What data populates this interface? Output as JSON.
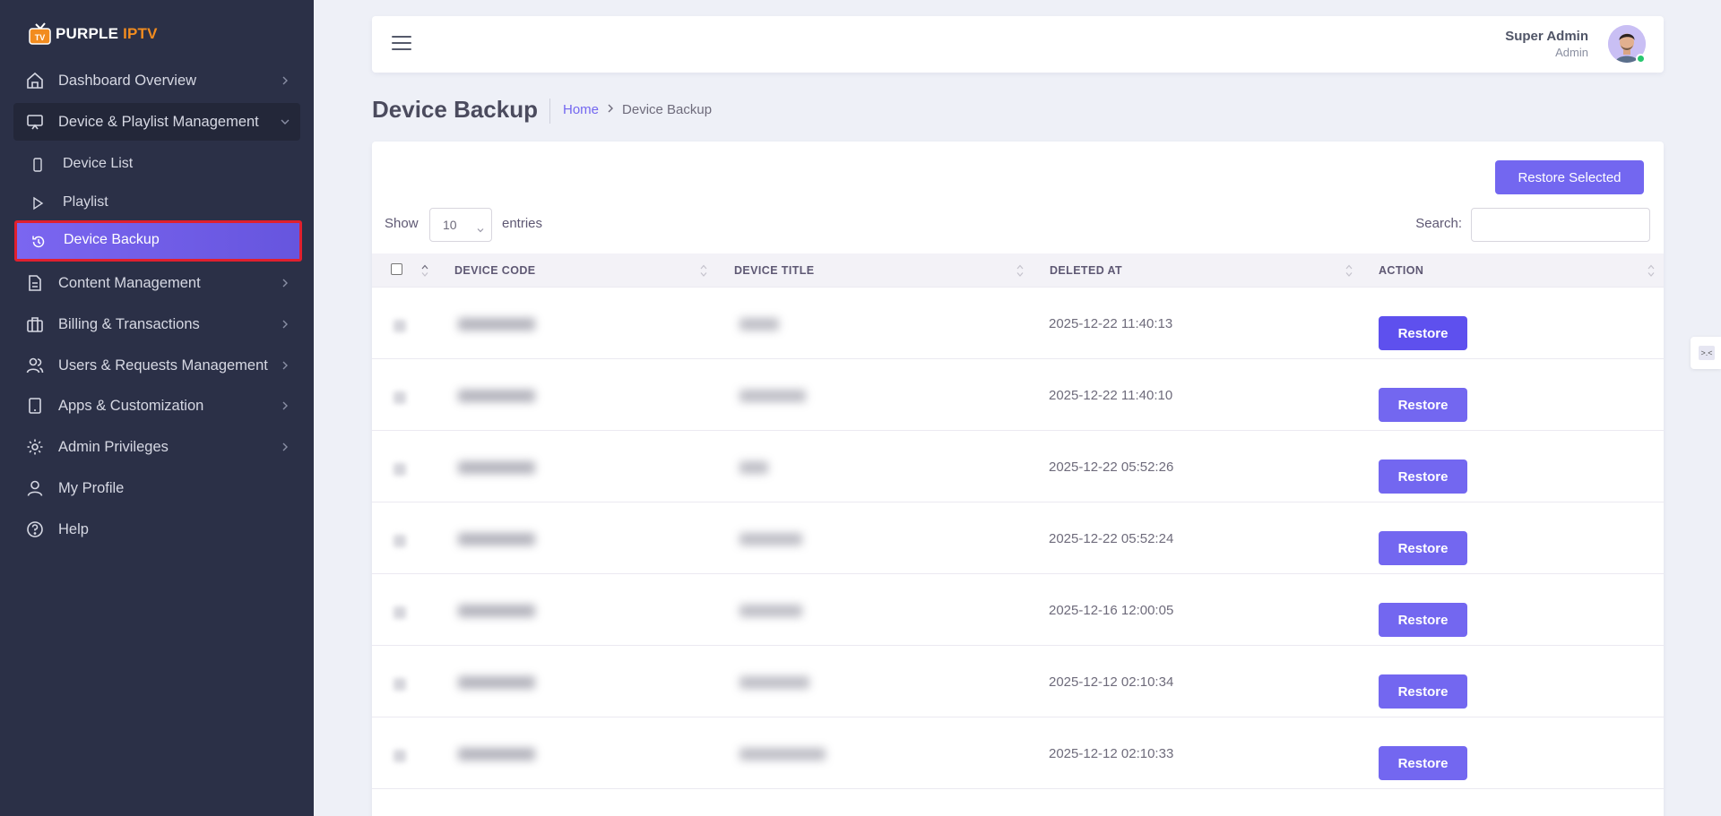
{
  "brand": {
    "name_main": "PURPLE",
    "name_accent": "IPTV",
    "logo_icon": "tv-icon",
    "accent_color": "#f28c1f"
  },
  "sidebar": {
    "items": [
      {
        "label": "Dashboard Overview",
        "icon": "home-icon"
      },
      {
        "label": "Device & Playlist Management",
        "icon": "monitor-icon"
      },
      {
        "label": "Content Management",
        "icon": "document-icon"
      },
      {
        "label": "Billing & Transactions",
        "icon": "briefcase-icon"
      },
      {
        "label": "Users & Requests Management",
        "icon": "users-icon"
      },
      {
        "label": "Apps & Customization",
        "icon": "tablet-icon"
      },
      {
        "label": "Admin Privileges",
        "icon": "gear-icon"
      },
      {
        "label": "My Profile",
        "icon": "user-icon"
      },
      {
        "label": "Help",
        "icon": "help-icon"
      }
    ],
    "subitems": [
      {
        "label": "Device List",
        "icon": "phone-icon"
      },
      {
        "label": "Playlist",
        "icon": "play-icon"
      },
      {
        "label": "Device Backup",
        "icon": "restore-icon"
      }
    ]
  },
  "header": {
    "user_name": "Super Admin",
    "user_role": "Admin"
  },
  "page": {
    "title": "Device Backup",
    "breadcrumb_home": "Home",
    "breadcrumb_current": "Device Backup"
  },
  "table_controls": {
    "restore_selected_label": "Restore Selected",
    "show_label": "Show",
    "page_length": "10",
    "entries_label": "entries",
    "search_label": "Search:"
  },
  "table": {
    "columns": [
      "DEVICE CODE",
      "DEVICE TITLE",
      "DELETED AT",
      "ACTION"
    ],
    "rows": [
      {
        "deleted_at": "2025-12-22 11:40:13",
        "action": "Restore"
      },
      {
        "deleted_at": "2025-12-22 11:40:10",
        "action": "Restore"
      },
      {
        "deleted_at": "2025-12-22 05:52:26",
        "action": "Restore"
      },
      {
        "deleted_at": "2025-12-22 05:52:24",
        "action": "Restore"
      },
      {
        "deleted_at": "2025-12-16 12:00:05",
        "action": "Restore"
      },
      {
        "deleted_at": "2025-12-12 02:10:34",
        "action": "Restore"
      },
      {
        "deleted_at": "2025-12-12 02:10:33",
        "action": "Restore"
      }
    ]
  },
  "colors": {
    "primary": "#7367f0",
    "sidebar_bg": "#2b3047",
    "active_highlight_border": "#e0202e",
    "online": "#28c76f"
  }
}
